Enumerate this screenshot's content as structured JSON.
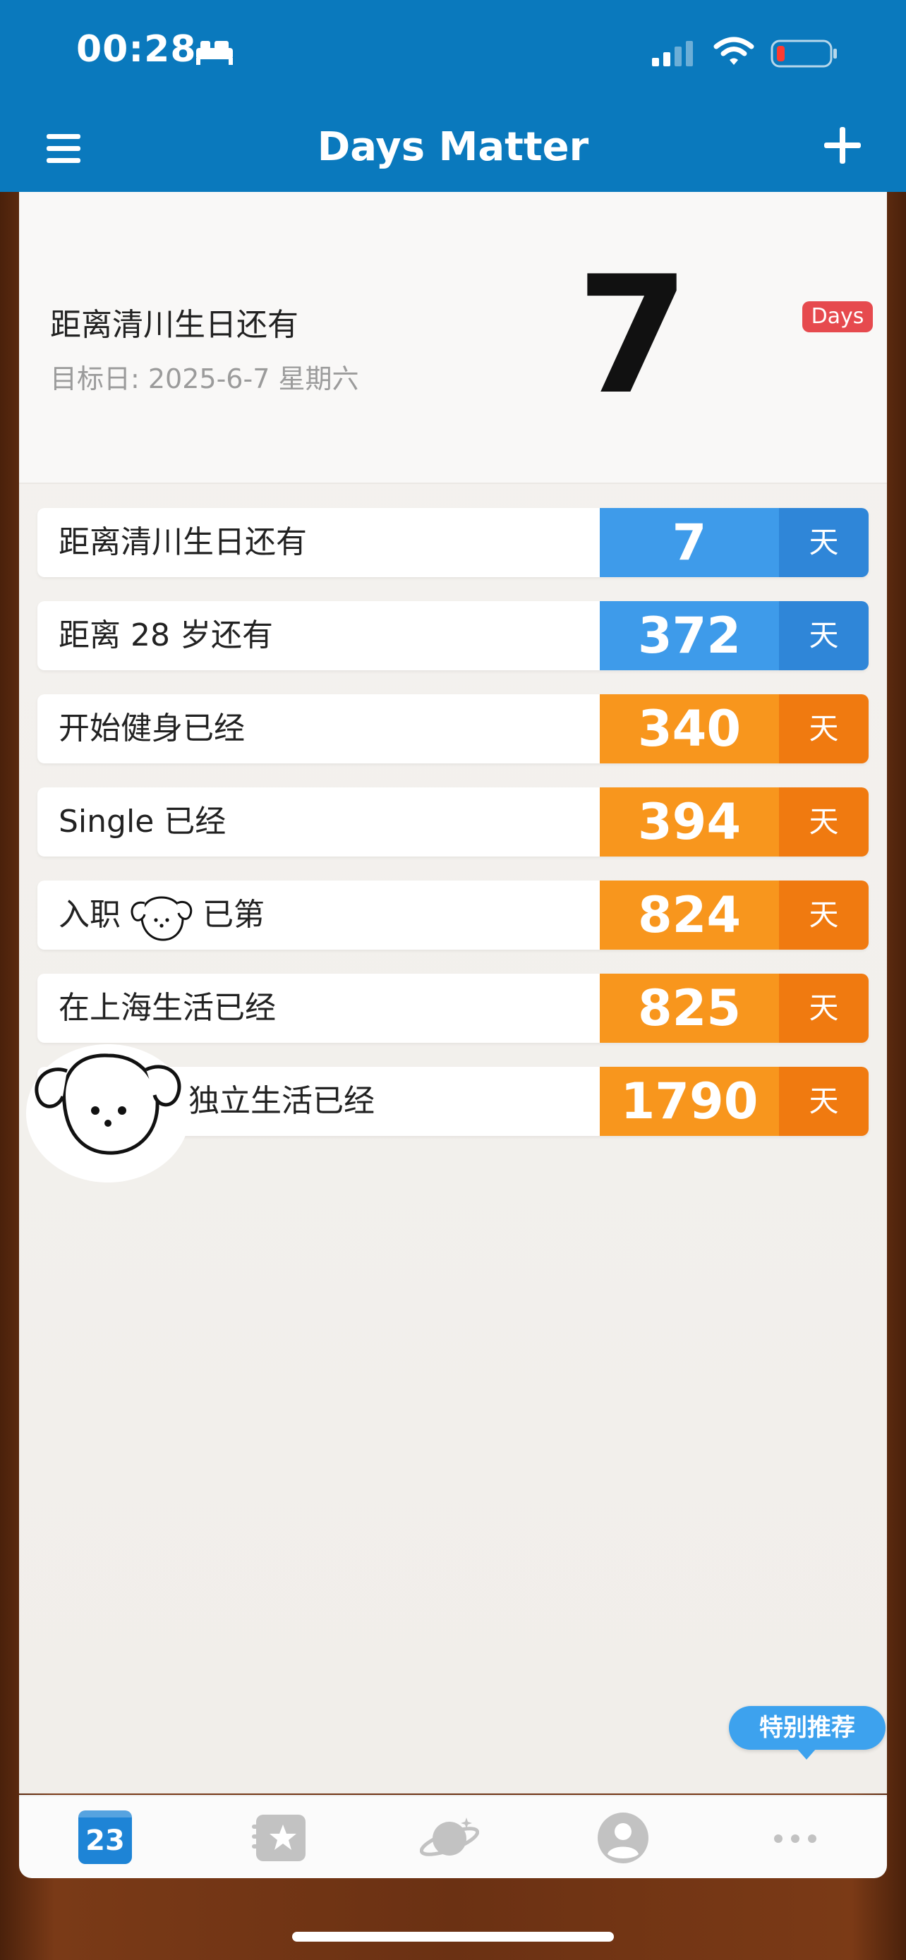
{
  "status": {
    "time": "00:28"
  },
  "nav": {
    "title": "Days Matter"
  },
  "hero": {
    "title": "距离清川生日还有",
    "date": "目标日: 2025-6-7 星期六",
    "count": "7",
    "badge": "Days"
  },
  "list": [
    {
      "title": "距离清川生日还有",
      "count": "7",
      "unit": "天",
      "color": "#3e9bea"
    },
    {
      "title": "距离 28 岁还有",
      "count": "372",
      "unit": "天",
      "color": "#3e9bea"
    },
    {
      "title": "开始健身已经",
      "count": "340",
      "unit": "天",
      "color": "#f8961d"
    },
    {
      "title": "Single 已经",
      "count": "394",
      "unit": "天",
      "color": "#f8961d"
    },
    {
      "title_before": "入职",
      "title_after": "已第",
      "count": "824",
      "unit": "天",
      "color": "#f8961d"
    },
    {
      "title": "在上海生活已经",
      "count": "825",
      "unit": "天",
      "color": "#f8961d"
    },
    {
      "title": "独立生活已经",
      "count": "1790",
      "unit": "天",
      "color": "#f8961d"
    }
  ],
  "promo": {
    "label": "特别推荐"
  },
  "tabbar": {
    "calendar_day": "23",
    "active_color": "#1e84d6",
    "inactive_color": "#c2c2c2"
  },
  "icons": [
    "bed-icon",
    "signal-icon",
    "wifi-icon",
    "battery-icon",
    "menu-icon",
    "add-icon",
    "puppy-icon",
    "calendar-icon",
    "star-icon",
    "planet-icon",
    "user-icon",
    "more-icon"
  ]
}
